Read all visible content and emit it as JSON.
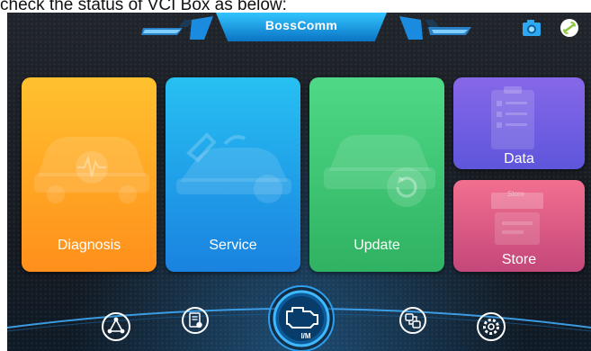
{
  "caption": "check the status of VCI Box as below:",
  "header": {
    "brand": "BossComm",
    "icons": [
      "camera-icon",
      "link-icon"
    ]
  },
  "tiles": {
    "diagnosis": "Diagnosis",
    "service": "Service",
    "update": "Update",
    "data": "Data",
    "store": "Store",
    "store_ticket": "Store"
  },
  "bottom_nav": {
    "center_label": "I/M",
    "items": [
      "network-icon",
      "report-icon",
      "engine-icon",
      "vci-connect-icon",
      "settings-icon"
    ]
  },
  "colors": {
    "diagnosis": "#ffa323",
    "service": "#1f9fea",
    "update": "#36c26a",
    "data": "#6e57e0",
    "store": "#d8527e",
    "header": "#1991e6"
  }
}
